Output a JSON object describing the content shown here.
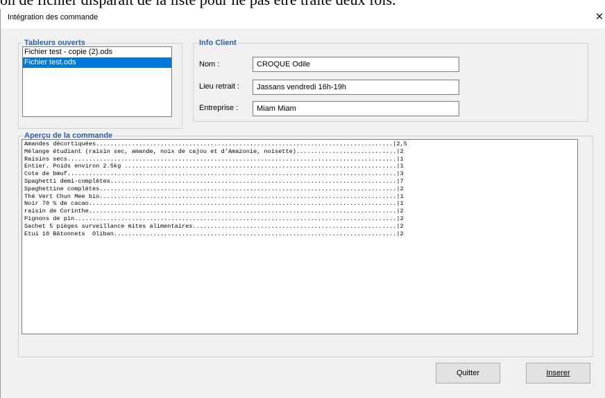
{
  "background_text": "on de fichier disparait de la liste pour ne pas etre traite deux fois.",
  "window": {
    "title": "Intégration des commande",
    "close_glyph": "✕"
  },
  "open_sheets": {
    "legend": "Tableurs ouverts",
    "items": [
      {
        "label": "Fichier test - copie (2).ods",
        "selected": false
      },
      {
        "label": "Fichier test.ods",
        "selected": true
      }
    ]
  },
  "client_info": {
    "legend": "Info Client",
    "name_label": "Nom :",
    "name_value": "CROQUE Odile",
    "pickup_label": "Lieu retrait :",
    "pickup_value": "Jassans vendredi 16h-19h",
    "company_label": "Entreprise :",
    "company_value": "Miam Miam"
  },
  "order_preview": {
    "legend": "Aperçu de la commande",
    "lines": [
      "Amandes décortiquées...................................................................................|2,5",
      "Mélange étudiant (raisin sec, amande, noix de cajou et d'Amazonie, noisette)............................|2",
      "Raisins secs............................................................................................|1",
      "Entier. Poids environ 2.5kg ............................................................................|1",
      "Cote de bœuf............................................................................................|3",
      "Spaghetti demi-complètes................................................................................|7",
      "Spaghettine complètes...................................................................................|2",
      "Thé Vert Chun Mee bio...................................................................................|1",
      "Noir 70 % de cacao......................................................................................|1",
      "raisin de Corinthe......................................................................................|2",
      "Pignons de pin..........................................................................................|2",
      "Sachet 5 pièges surveillance mites alimentaires.........................................................|2",
      "Etui 10 Bâtonnets  Oliban...............................................................................|2"
    ]
  },
  "buttons": {
    "quit": "Quitter",
    "insert": "Inserer"
  },
  "colors": {
    "accent": "#0078d7",
    "legend": "#2a5fa6",
    "window_bg": "#f0f0f0"
  }
}
